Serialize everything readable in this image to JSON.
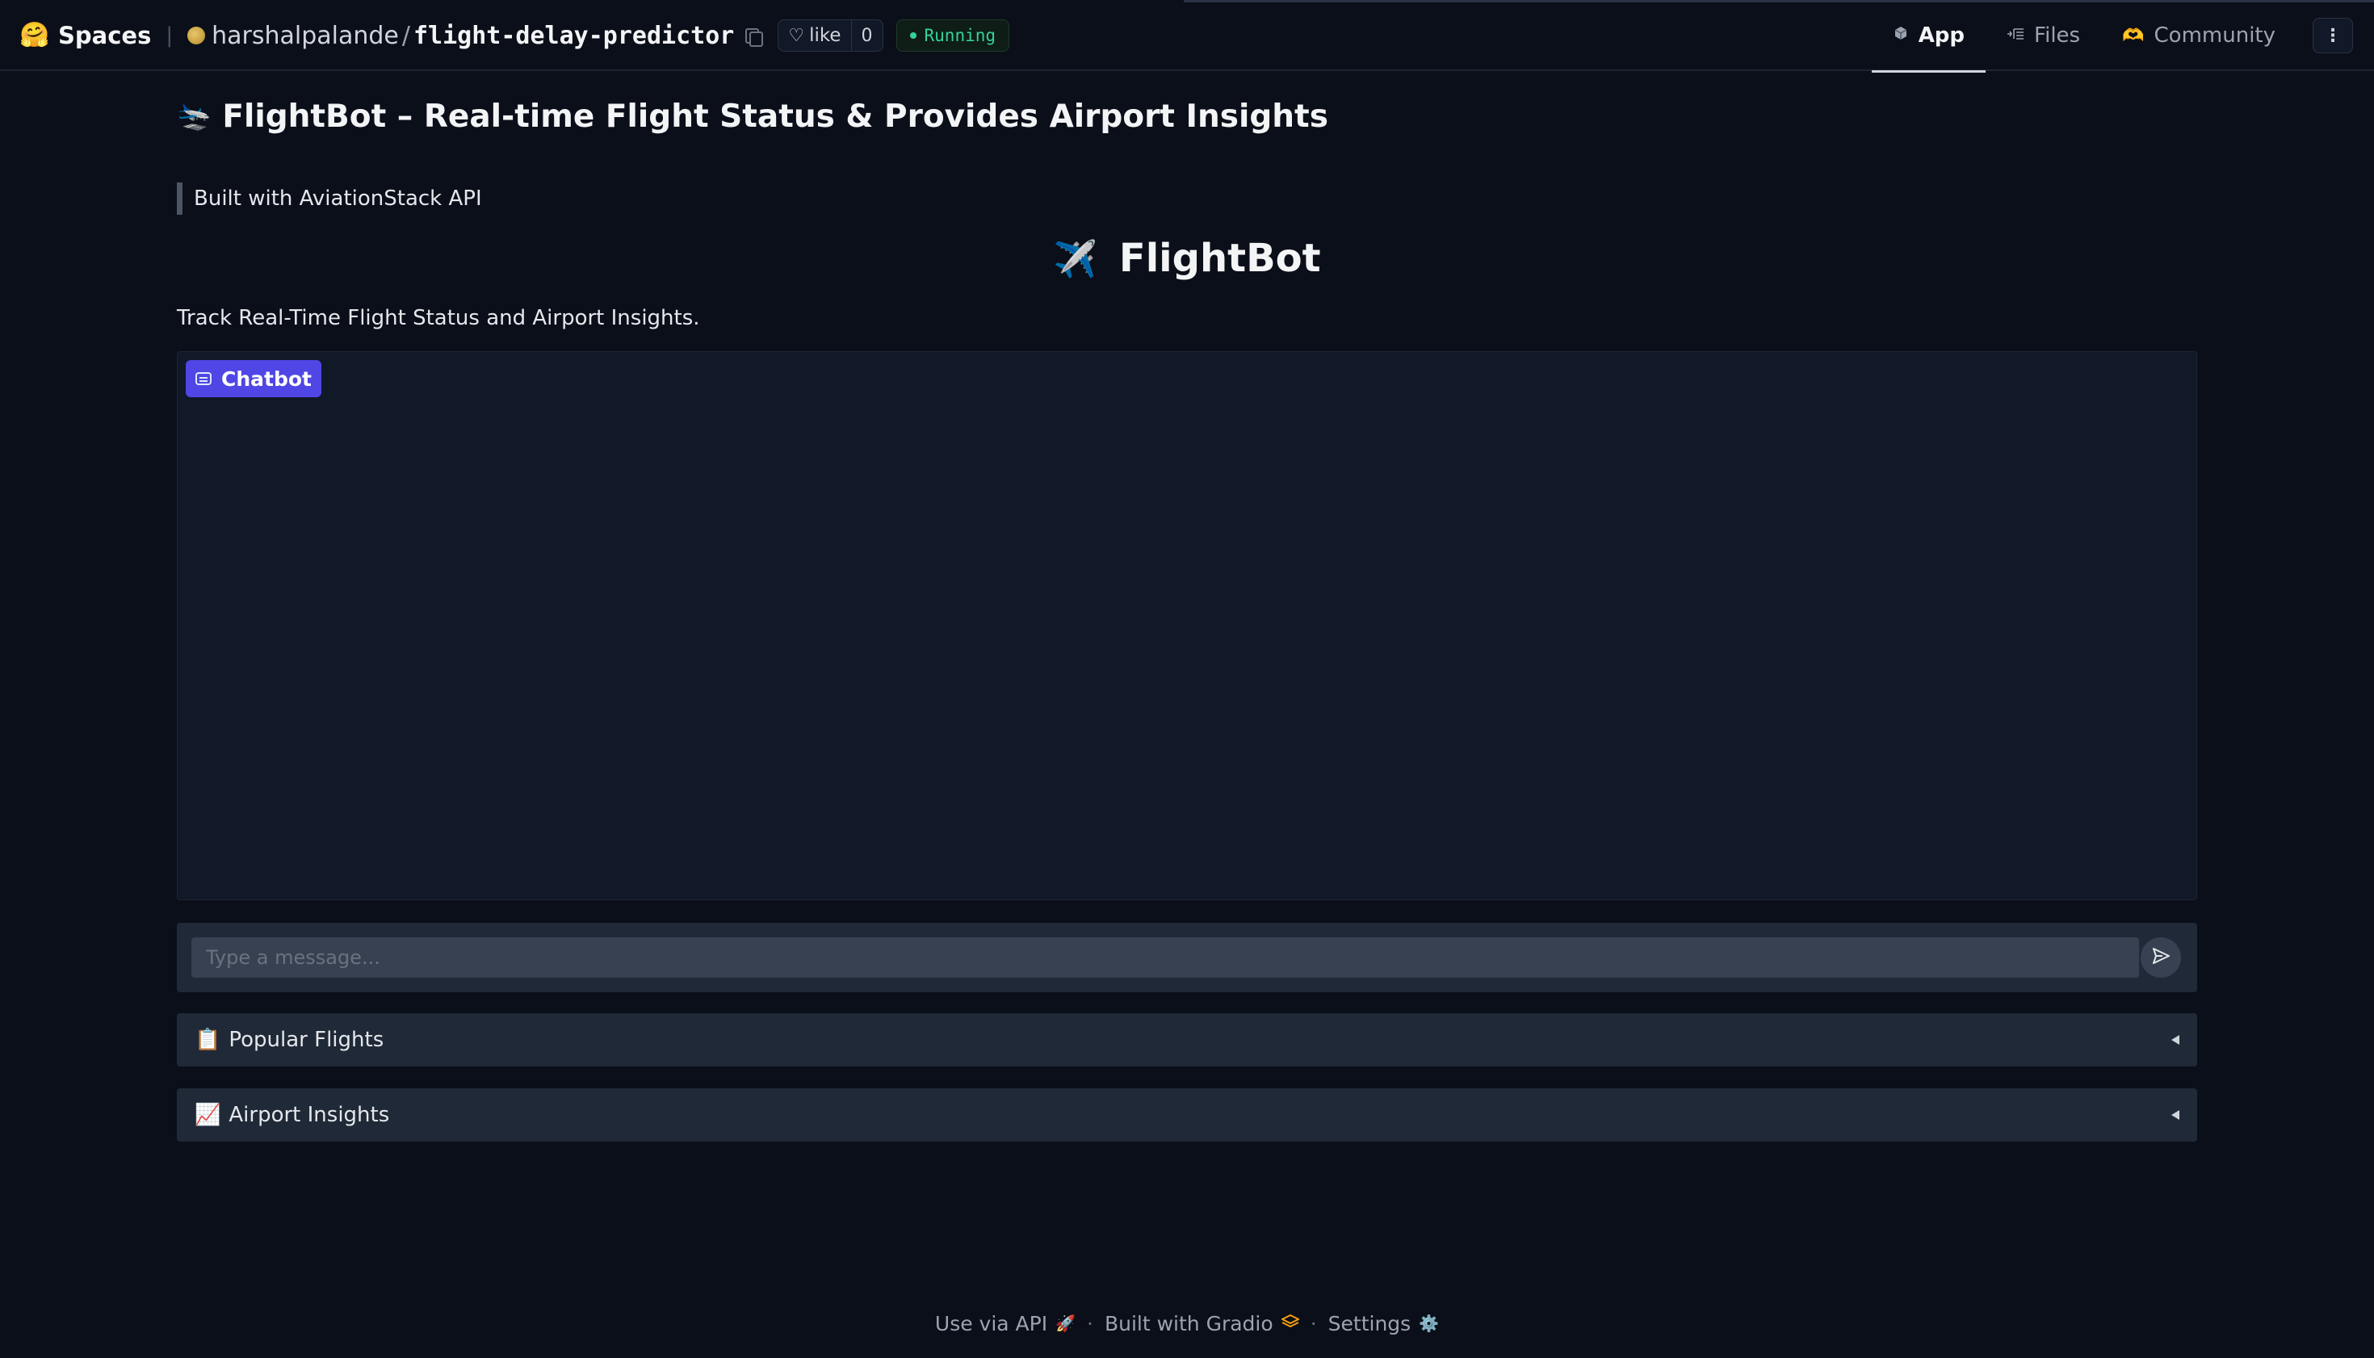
{
  "header": {
    "spaces_label": "Spaces",
    "owner": "harshalpalande",
    "separator": "/",
    "repo": "flight-delay-predictor",
    "like_label": "like",
    "like_count": "0",
    "status": "Running",
    "tabs": [
      {
        "label": "App",
        "icon": "cube-icon",
        "active": true
      },
      {
        "label": "Files",
        "icon": "files-icon",
        "active": false
      },
      {
        "label": "Community",
        "icon": "community-icon",
        "active": false
      }
    ]
  },
  "app": {
    "title_emoji": "🛬",
    "title": "FlightBot – Real-time Flight Status & Provides Airport Insights",
    "blockquote": "Built with AviationStack API",
    "heading_emoji": "✈️",
    "heading": "FlightBot",
    "tagline": "Track Real-Time Flight Status and Airport Insights.",
    "chatbot_label": "Chatbot",
    "input_placeholder": "Type a message...",
    "accordions": [
      {
        "emoji": "📋",
        "label": "Popular Flights"
      },
      {
        "emoji": "📈",
        "label": "Airport Insights"
      }
    ]
  },
  "footer": {
    "api_label": "Use via API",
    "api_icon": "🚀",
    "gradio_label": "Built with Gradio",
    "gradio_icon": "gradio-logo-icon",
    "settings_label": "Settings",
    "settings_icon": "⚙️"
  },
  "colors": {
    "background": "#0b0f19",
    "chatbot_badge": "#4f46e5",
    "status_green": "#34d399"
  }
}
